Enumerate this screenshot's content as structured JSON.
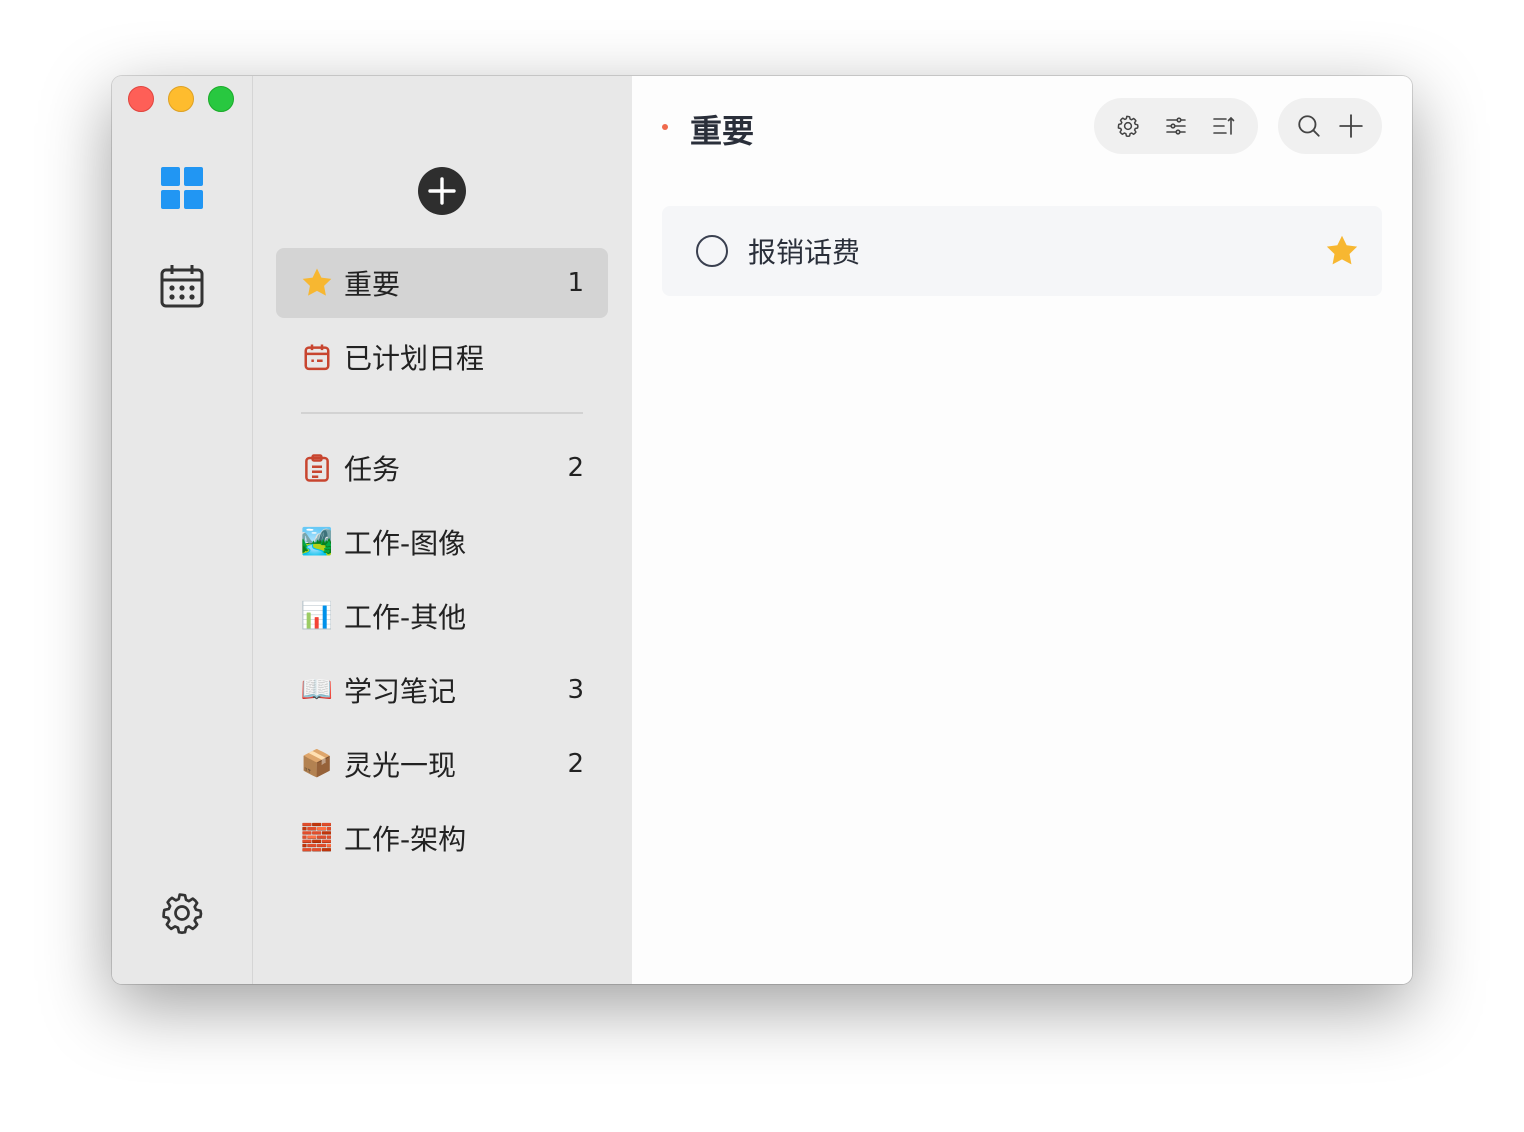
{
  "rail": {
    "icons": {
      "apps": "grid-icon",
      "calendar": "calendar-icon",
      "settings": "gear-icon"
    }
  },
  "lists": {
    "add_icon": "plus-circle-icon",
    "smart": [
      {
        "icon": "star-icon",
        "label": "重要",
        "count": "1",
        "active": true
      },
      {
        "icon": "calendar-list-icon",
        "label": "已计划日程",
        "count": ""
      }
    ],
    "user": [
      {
        "icon": "clipboard-icon",
        "label": "任务",
        "count": "2"
      },
      {
        "icon": "🏞️",
        "label": "工作-图像",
        "count": ""
      },
      {
        "icon": "📊",
        "label": "工作-其他",
        "count": ""
      },
      {
        "icon": "📖",
        "label": "学习笔记",
        "count": "3"
      },
      {
        "icon": "📦",
        "label": "灵光一现",
        "count": "2"
      },
      {
        "icon": "🧱",
        "label": "工作-架构",
        "count": ""
      }
    ]
  },
  "main": {
    "title": "重要",
    "toolbar": [
      "gear-icon",
      "sliders-icon",
      "sort-icon",
      "search-icon",
      "plus-icon"
    ],
    "tasks": [
      {
        "title": "报销话费",
        "done": false,
        "starred": true
      }
    ]
  },
  "colors": {
    "accent_blue": "#2196f3",
    "star": "#f7b731",
    "list_icon_red": "#c8452f",
    "title_dot": "#f06a4d"
  }
}
